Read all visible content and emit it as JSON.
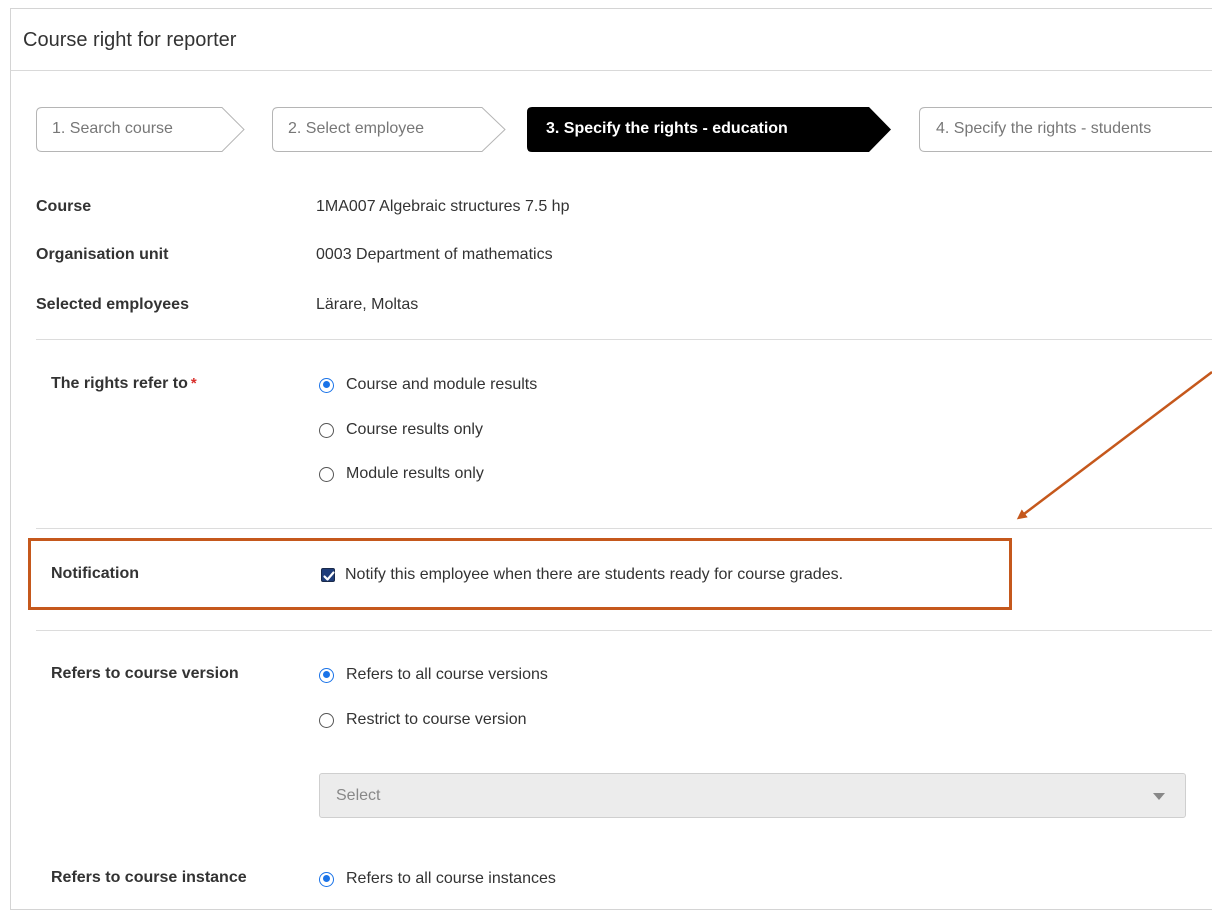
{
  "header": {
    "title": "Course right for reporter"
  },
  "steps": [
    {
      "label": "1. Search course",
      "state": "done"
    },
    {
      "label": "2. Select employee",
      "state": "done"
    },
    {
      "label": "3. Specify the rights - education",
      "state": "active"
    },
    {
      "label": "4. Specify the rights - students",
      "state": "upcoming"
    }
  ],
  "info": {
    "course_label": "Course",
    "course_value": "1MA007 Algebraic structures 7.5 hp",
    "org_label": "Organisation unit",
    "org_value": "0003 Department of mathematics",
    "employees_label": "Selected employees",
    "employees_value": "Lärare, Moltas"
  },
  "rights_refer": {
    "label": "The rights refer to",
    "required_mark": "*",
    "options": [
      {
        "label": "Course and module results",
        "checked": true
      },
      {
        "label": "Course results only",
        "checked": false
      },
      {
        "label": "Module results only",
        "checked": false
      }
    ]
  },
  "notification": {
    "label": "Notification",
    "checkbox_label": "Notify this employee when there are students ready for course grades.",
    "checked": true
  },
  "course_version": {
    "label": "Refers to course version",
    "options": [
      {
        "label": "Refers to all course versions",
        "checked": true
      },
      {
        "label": "Restrict to course version",
        "checked": false
      }
    ],
    "select_placeholder": "Select"
  },
  "course_instance": {
    "label": "Refers to course instance",
    "options": [
      {
        "label": "Refers to all course instances",
        "checked": true
      }
    ]
  },
  "colors": {
    "highlight": "#c5581c",
    "radio_accent": "#1a73e8",
    "active_step_bg": "#000000",
    "required": "#d9302c"
  }
}
